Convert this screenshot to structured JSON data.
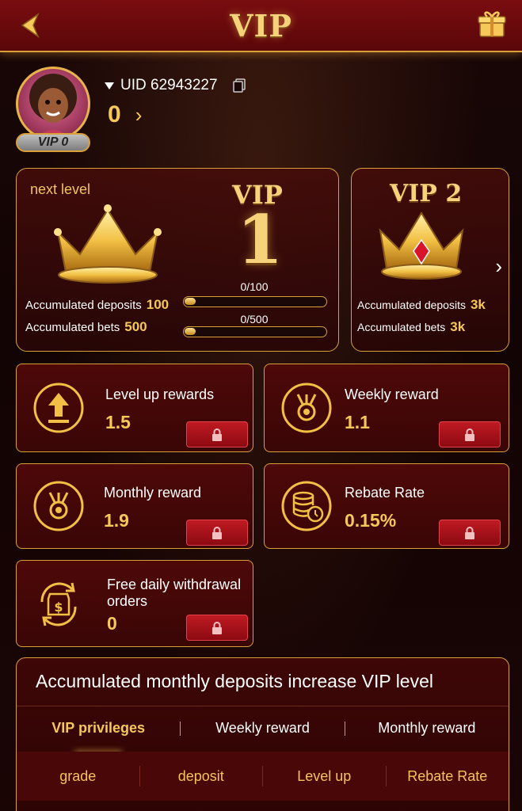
{
  "header": {
    "title": "VIP",
    "back_icon": "back-arrow-icon",
    "gift_icon": "gift-icon"
  },
  "profile": {
    "vip_badge": "VIP 0",
    "uid": "UID 62943227",
    "balance": "0",
    "balance_chevron": "›"
  },
  "level_card": {
    "next_level_label": "next level",
    "vip_word": "VIP",
    "vip_number": "1",
    "deposits_label": "Accumulated deposits",
    "deposits_value": "100",
    "deposits_progress": "0/100",
    "deposits_progress_fraction": 0,
    "bets_label": "Accumulated bets",
    "bets_value": "500",
    "bets_progress": "0/500",
    "bets_progress_fraction": 0
  },
  "level2_card": {
    "title": "VIP 2",
    "deposits_label": "Accumulated deposits",
    "deposits_value": "3k",
    "bets_label": "Accumulated bets",
    "bets_value": "3k",
    "arrow": "›"
  },
  "rewards": [
    {
      "title": "Level up rewards",
      "value": "1.5",
      "icon": "upload-arrow-icon"
    },
    {
      "title": "Weekly reward",
      "value": "1.1",
      "icon": "medal-icon"
    },
    {
      "title": "Monthly reward",
      "value": "1.9",
      "icon": "medal-icon"
    },
    {
      "title": "Rebate Rate",
      "value": "0.15%",
      "icon": "coin-stack-icon"
    },
    {
      "title": "Free daily withdrawal orders",
      "value": "0",
      "icon": "dollar-exchange-icon"
    }
  ],
  "panel": {
    "title": "Accumulated monthly deposits increase VIP level",
    "tabs": [
      "VIP privileges",
      "Weekly reward",
      "Monthly reward"
    ],
    "active_tab": "VIP privileges",
    "columns": [
      "grade",
      "deposit",
      "Level up",
      "Rebate Rate"
    ]
  },
  "colors": {
    "gold": "#f6c85a",
    "red_header": "#7a0d10",
    "lock_red": "#c01a22"
  }
}
